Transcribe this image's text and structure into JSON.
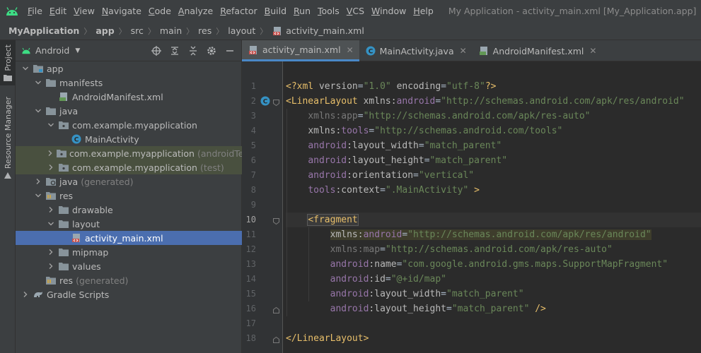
{
  "menubar": {
    "items": [
      "File",
      "Edit",
      "View",
      "Navigate",
      "Code",
      "Analyze",
      "Refactor",
      "Build",
      "Run",
      "Tools",
      "VCS",
      "Window",
      "Help"
    ],
    "window_title": "My Application - activity_main.xml [My_Application.app]"
  },
  "breadcrumb": [
    "MyApplication",
    "app",
    "src",
    "main",
    "res",
    "layout",
    "activity_main.xml"
  ],
  "toolstrip": {
    "project_label": "Project",
    "resource_manager_label": "Resource Manager"
  },
  "project_panel": {
    "view_mode": "Android",
    "tree": [
      {
        "label": "app",
        "muted": "",
        "depth": 0,
        "expanded": true,
        "icon": "folder-module-icon",
        "state": ""
      },
      {
        "label": "manifests",
        "muted": "",
        "depth": 1,
        "expanded": true,
        "icon": "folder-icon",
        "state": ""
      },
      {
        "label": "AndroidManifest.xml",
        "muted": "",
        "depth": 2,
        "expanded": null,
        "icon": "manifest-file-icon",
        "state": ""
      },
      {
        "label": "java",
        "muted": "",
        "depth": 1,
        "expanded": true,
        "icon": "folder-icon",
        "state": ""
      },
      {
        "label": "com.example.myapplication",
        "muted": "",
        "depth": 2,
        "expanded": true,
        "icon": "package-icon",
        "state": ""
      },
      {
        "label": "MainActivity",
        "muted": "",
        "depth": 3,
        "expanded": null,
        "icon": "class-icon",
        "state": ""
      },
      {
        "label": "com.example.myapplication",
        "muted": "(androidTest)",
        "depth": 2,
        "expanded": false,
        "icon": "package-icon",
        "state": "test"
      },
      {
        "label": "com.example.myapplication",
        "muted": "(test)",
        "depth": 2,
        "expanded": false,
        "icon": "package-icon",
        "state": "test"
      },
      {
        "label": "java",
        "muted": "(generated)",
        "depth": 1,
        "expanded": false,
        "icon": "generated-folder-icon",
        "state": ""
      },
      {
        "label": "res",
        "muted": "",
        "depth": 1,
        "expanded": true,
        "icon": "res-folder-icon",
        "state": ""
      },
      {
        "label": "drawable",
        "muted": "",
        "depth": 2,
        "expanded": false,
        "icon": "folder-icon",
        "state": ""
      },
      {
        "label": "layout",
        "muted": "",
        "depth": 2,
        "expanded": true,
        "icon": "folder-icon",
        "state": ""
      },
      {
        "label": "activity_main.xml",
        "muted": "",
        "depth": 3,
        "expanded": null,
        "icon": "layout-file-icon",
        "state": "selected"
      },
      {
        "label": "mipmap",
        "muted": "",
        "depth": 2,
        "expanded": false,
        "icon": "folder-icon",
        "state": ""
      },
      {
        "label": "values",
        "muted": "",
        "depth": 2,
        "expanded": false,
        "icon": "folder-icon",
        "state": ""
      },
      {
        "label": "res",
        "muted": "(generated)",
        "depth": 1,
        "expanded": null,
        "icon": "res-folder-icon",
        "state": ""
      },
      {
        "label": "Gradle Scripts",
        "muted": "",
        "depth": 0,
        "expanded": false,
        "icon": "gradle-icon",
        "state": ""
      }
    ]
  },
  "tabs": [
    {
      "label": "activity_main.xml",
      "icon": "layout-file-icon",
      "active": true
    },
    {
      "label": "MainActivity.java",
      "icon": "class-icon",
      "active": false
    },
    {
      "label": "AndroidManifest.xml",
      "icon": "manifest-file-icon",
      "active": false
    }
  ],
  "editor": {
    "current_line": 10,
    "lines": [
      {
        "n": "1",
        "indent": 0,
        "tokens": [
          [
            "pi",
            "<?xml "
          ],
          [
            "attr",
            "version"
          ],
          [
            "plain",
            "="
          ],
          [
            "val",
            "\"1.0\""
          ],
          [
            "plain",
            " "
          ],
          [
            "attr",
            "encoding"
          ],
          [
            "plain",
            "="
          ],
          [
            "val",
            "\"utf-8\""
          ],
          [
            "pi",
            "?>"
          ]
        ]
      },
      {
        "n": "2",
        "indent": 0,
        "tokens": [
          [
            "tag",
            "<LinearLayout "
          ],
          [
            "attr",
            "xmlns:"
          ],
          [
            "ns",
            "android"
          ],
          [
            "plain",
            "="
          ],
          [
            "val",
            "\"http://schemas.android.com/apk/res/android\""
          ]
        ]
      },
      {
        "n": "3",
        "indent": 4,
        "tokens": [
          [
            "dim",
            "xmlns:app"
          ],
          [
            "plain",
            "="
          ],
          [
            "val",
            "\"http://schemas.android.com/apk/res-auto\""
          ]
        ]
      },
      {
        "n": "4",
        "indent": 4,
        "tokens": [
          [
            "attr",
            "xmlns:"
          ],
          [
            "ns",
            "tools"
          ],
          [
            "plain",
            "="
          ],
          [
            "val",
            "\"http://schemas.android.com/tools\""
          ]
        ]
      },
      {
        "n": "5",
        "indent": 4,
        "tokens": [
          [
            "ns",
            "android"
          ],
          [
            "attr",
            ":layout_width"
          ],
          [
            "plain",
            "="
          ],
          [
            "val",
            "\"match_parent\""
          ]
        ]
      },
      {
        "n": "6",
        "indent": 4,
        "tokens": [
          [
            "ns",
            "android"
          ],
          [
            "attr",
            ":layout_height"
          ],
          [
            "plain",
            "="
          ],
          [
            "val",
            "\"match_parent\""
          ]
        ]
      },
      {
        "n": "7",
        "indent": 4,
        "tokens": [
          [
            "ns",
            "android"
          ],
          [
            "attr",
            ":orientation"
          ],
          [
            "plain",
            "="
          ],
          [
            "val",
            "\"vertical\""
          ]
        ]
      },
      {
        "n": "8",
        "indent": 4,
        "tokens": [
          [
            "ns",
            "tools"
          ],
          [
            "attr",
            ":context"
          ],
          [
            "plain",
            "="
          ],
          [
            "val",
            "\".MainActivity\""
          ],
          [
            "plain",
            " "
          ],
          [
            "tag",
            ">"
          ]
        ]
      },
      {
        "n": "9",
        "indent": 0,
        "tokens": []
      },
      {
        "n": "10",
        "indent": 4,
        "tokens": [
          [
            "tagbox",
            "<fragment"
          ]
        ]
      },
      {
        "n": "11",
        "indent": 8,
        "tokens": [
          [
            "hlattr",
            "xmlns:"
          ],
          [
            "hlns",
            "android"
          ],
          [
            "hlplain",
            "="
          ],
          [
            "hlval",
            "\"http://schemas.android.com/apk/res/android\""
          ]
        ]
      },
      {
        "n": "12",
        "indent": 8,
        "tokens": [
          [
            "dim",
            "xmlns:map"
          ],
          [
            "plain",
            "="
          ],
          [
            "val",
            "\"http://schemas.android.com/apk/res-auto\""
          ]
        ]
      },
      {
        "n": "13",
        "indent": 8,
        "tokens": [
          [
            "ns",
            "android"
          ],
          [
            "attr",
            ":name"
          ],
          [
            "plain",
            "="
          ],
          [
            "val",
            "\"com.google.android.gms.maps.SupportMapFragment\""
          ]
        ]
      },
      {
        "n": "14",
        "indent": 8,
        "tokens": [
          [
            "ns",
            "android"
          ],
          [
            "attr",
            ":id"
          ],
          [
            "plain",
            "="
          ],
          [
            "val",
            "\"@+id/map\""
          ]
        ]
      },
      {
        "n": "15",
        "indent": 8,
        "tokens": [
          [
            "ns",
            "android"
          ],
          [
            "attr",
            ":layout_width"
          ],
          [
            "plain",
            "="
          ],
          [
            "val",
            "\"match_parent\""
          ]
        ]
      },
      {
        "n": "16",
        "indent": 8,
        "tokens": [
          [
            "ns",
            "android"
          ],
          [
            "attr",
            ":layout_height"
          ],
          [
            "plain",
            "="
          ],
          [
            "val",
            "\"match_parent\""
          ],
          [
            "plain",
            " "
          ],
          [
            "tag",
            "/>"
          ]
        ]
      },
      {
        "n": "17",
        "indent": 0,
        "tokens": []
      },
      {
        "n": "18",
        "indent": 0,
        "tokens": [
          [
            "tag",
            "</LinearLayout>"
          ]
        ]
      }
    ]
  },
  "colors": {
    "accent": "#4b6eaf",
    "tag": "#e8bf6a",
    "namespace": "#9876aa",
    "string": "#6a8759"
  }
}
